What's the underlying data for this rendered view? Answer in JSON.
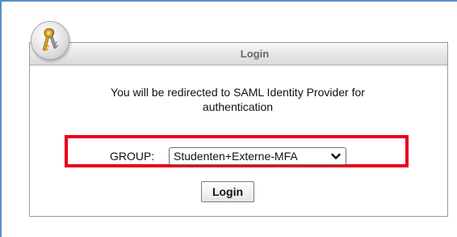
{
  "panel": {
    "title": "Login",
    "icon": "keys-icon"
  },
  "message": "You will be redirected to SAML Identity Provider for authentication",
  "group": {
    "label": "GROUP:",
    "selected": "Studenten+Externe-MFA"
  },
  "login_button": "Login",
  "colors": {
    "highlight_border": "#e8001c",
    "frame": "#5b8cc9"
  }
}
